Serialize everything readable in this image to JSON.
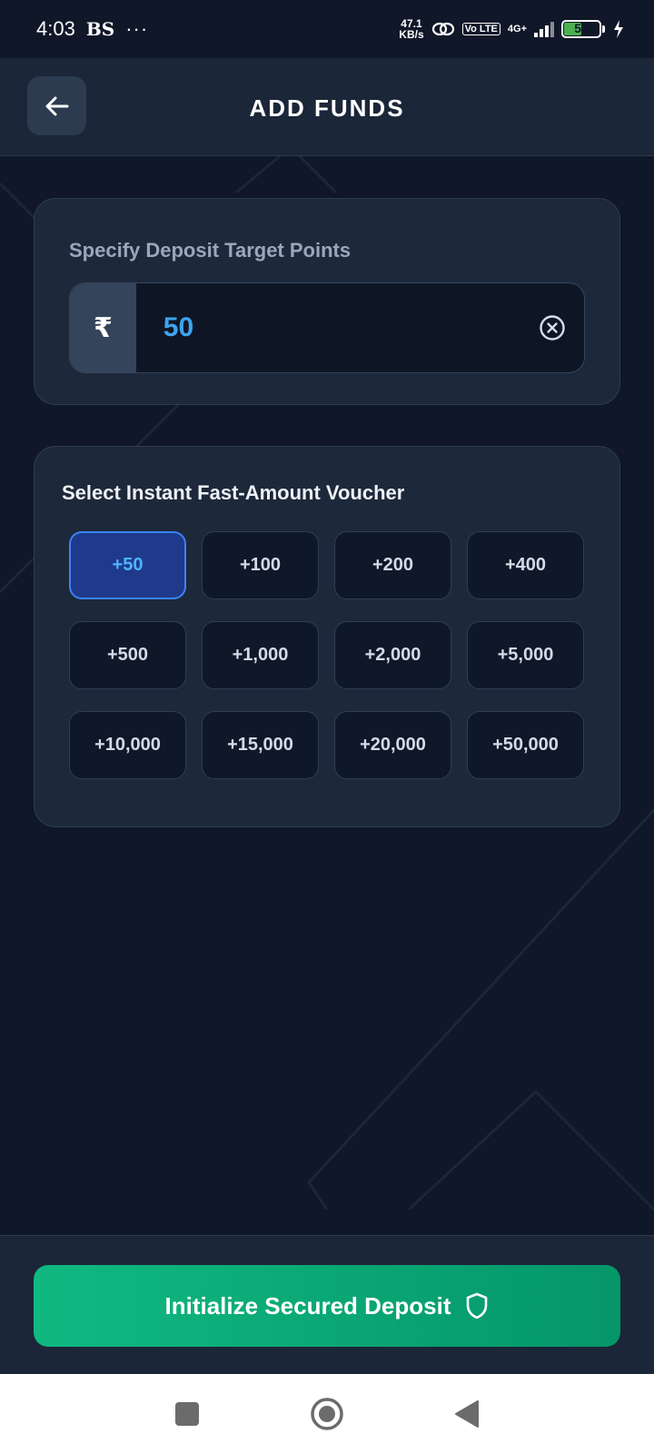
{
  "status_bar": {
    "time": "4:03",
    "carrier": "BS",
    "overflow": "···",
    "speed_value": "47.1",
    "speed_unit": "KB/s",
    "volte": "Vo LTE",
    "network": "4G+",
    "battery": "50"
  },
  "header": {
    "title": "ADD FUNDS",
    "back_icon": "arrow-left-icon"
  },
  "target": {
    "label": "Specify Deposit Target Points",
    "currency_symbol": "₹",
    "amount": "50",
    "clear_icon": "clear-circle-icon"
  },
  "vouchers": {
    "title": "Select Instant Fast-Amount Voucher",
    "selected": "+50",
    "items": [
      "+50",
      "+100",
      "+200",
      "+400",
      "+500",
      "+1,000",
      "+2,000",
      "+5,000",
      "+10,000",
      "+15,000",
      "+20,000",
      "+50,000"
    ]
  },
  "footer": {
    "deposit_label": "Initialize Secured Deposit",
    "deposit_icon": "shield-icon"
  },
  "nav": {
    "recents_icon": "square-icon",
    "home_icon": "circle-icon",
    "back_icon": "triangle-back-icon"
  },
  "colors": {
    "background": "#0f1729",
    "card": "#1d283b",
    "accent_blue": "#3b82f6",
    "amount_text": "#3fa3ee",
    "cta_green": "#10b981"
  }
}
